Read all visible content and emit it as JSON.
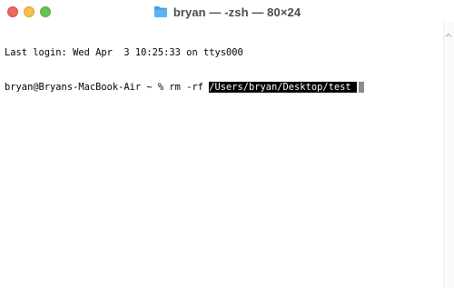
{
  "window": {
    "title": "bryan — -zsh — 80×24"
  },
  "terminal": {
    "last_login": "Last login: Wed Apr  3 10:25:33 on ttys000",
    "prompt": "bryan@Bryans-MacBook-Air ~ % ",
    "command": "rm -rf ",
    "selected_path": "/Users/bryan/Desktop/test "
  },
  "colors": {
    "close": "#ed6a5e",
    "minimize": "#f5bf4f",
    "zoom": "#61c554",
    "folder": "#5eb2f0",
    "selection_bg": "#000000",
    "cursor": "#8c8c8c"
  },
  "icons": {
    "title_icon": "folder-icon",
    "scroll_icon": "chevron-up-icon"
  }
}
